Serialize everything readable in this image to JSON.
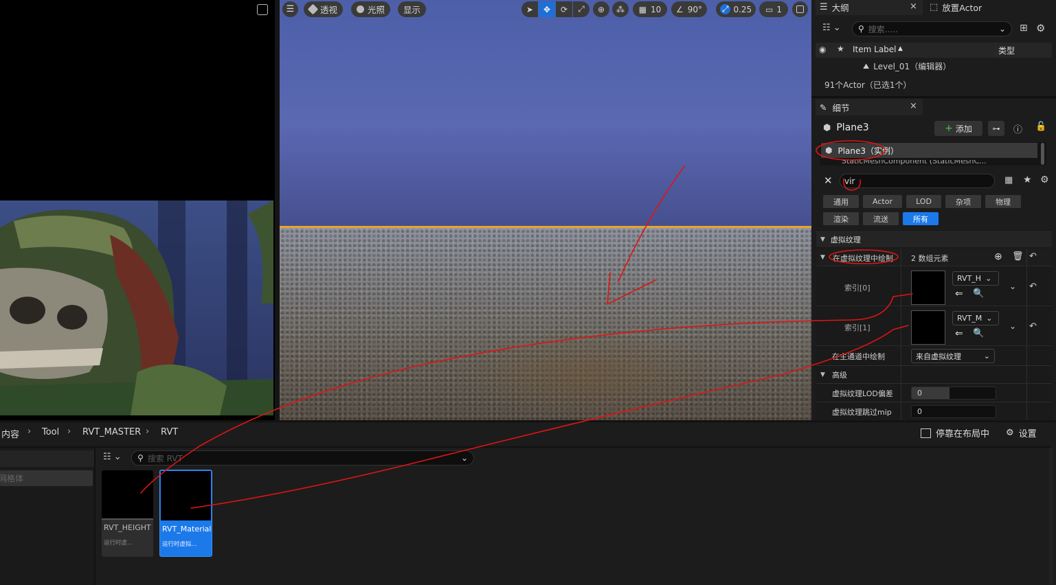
{
  "viewport_left": {
    "scene_caption": ""
  },
  "viewport_toolbar": {
    "perspective": "透视",
    "lighting": "光照",
    "show": "显示",
    "grid_snap": "10",
    "angle_snap": "90°",
    "scale_snap": "0.25",
    "camera_speed": "1"
  },
  "outliner": {
    "tab_outline": "大纲",
    "tab_place_actor": "放置Actor",
    "search_placeholder": "搜索.....",
    "col_item_label": "Item Label",
    "col_type": "类型",
    "level_item": "Level_01（编辑器）",
    "actor_count": "91个Actor（已选1个）"
  },
  "details": {
    "tab_title": "细节",
    "object_name": "Plane3",
    "add_button": "添加",
    "component_instance": "Plane3（实例）",
    "component_partial": "StaticMeshComponent (StaticMeshC...",
    "search_value": "vir",
    "filter_chips_row1": [
      "通用",
      "Actor",
      "LOD",
      "杂项",
      "物理"
    ],
    "filter_chips_row2": [
      "渲染",
      "流送",
      "所有"
    ],
    "section_virtual_texture": "虚拟纹理",
    "draw_in_vt_label": "在虚拟纹理中绘制",
    "array_count": "2 数组元素",
    "index0_label": "索引[0]",
    "index0_asset": "RVT_H",
    "index1_label": "索引[1]",
    "index1_asset": "RVT_M",
    "draw_in_main_pass_label": "在主通道中绘制",
    "draw_in_main_pass_value": "来自虚拟纹理",
    "section_advanced": "高级",
    "lod_bias_label": "虚拟纹理LOD偏差",
    "lod_bias_value": "0",
    "skip_mips_label": "虚拟纹理跳过mip",
    "skip_mips_value": "0"
  },
  "content_browser": {
    "breadcrumb": [
      "内容",
      "Tool",
      "RVT_MASTER",
      "RVT"
    ],
    "dock_label": "停靠在布局中",
    "settings_label": "设置",
    "search_placeholder": "搜索 RVT",
    "left_filter_item": "网格体",
    "assets": [
      {
        "name": "RVT_HEIGHT",
        "type": "运行时虚...",
        "selected": false
      },
      {
        "name": "RVT_Material",
        "type": "运行时虚拟...",
        "selected": true
      }
    ]
  },
  "colors": {
    "accent": "#1b79ea",
    "annotation": "#e01414",
    "sky_top": "#4b5ea8",
    "horizon": "#e8a52c"
  }
}
